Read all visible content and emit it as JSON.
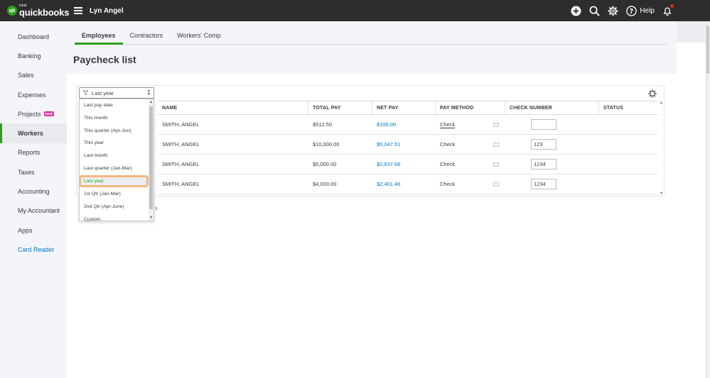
{
  "app": {
    "brand_small": "intuit",
    "brand": "quickbooks",
    "company": "Lyn Angel"
  },
  "topbar": {
    "help_label": "Help",
    "icons": [
      "plus-icon",
      "search-icon",
      "gear-icon",
      "help-icon",
      "bell-icon"
    ]
  },
  "sidebar": {
    "items": [
      {
        "label": "Dashboard"
      },
      {
        "label": "Banking"
      },
      {
        "label": "Sales"
      },
      {
        "label": "Expenses"
      },
      {
        "label": "Projects",
        "badge": "NEW"
      },
      {
        "label": "Workers",
        "active": true
      },
      {
        "label": "Reports"
      },
      {
        "label": "Taxes"
      },
      {
        "label": "Accounting"
      },
      {
        "label": "My Accountant"
      },
      {
        "label": "Apps"
      },
      {
        "label": "Card Reader"
      }
    ]
  },
  "tabs": [
    "Employees",
    "Contractors",
    "Workers' Comp"
  ],
  "page_title": "Paycheck list",
  "filter": {
    "selected": "Last year",
    "options": [
      "Last pay date",
      "This month",
      "This quarter (Apr-Jun)",
      "This year",
      "Last month",
      "Last quarter (Jan-Mar)",
      "Last year",
      "1st Qtr (Jan-Mar)",
      "2nd Qtr (Apr-June)",
      "Custom"
    ]
  },
  "table": {
    "columns": [
      "NAME",
      "TOTAL PAY",
      "NET PAY",
      "PAY METHOD",
      "CHECK NUMBER",
      "STATUS"
    ],
    "rows": [
      {
        "name": "SMITH, ANGEL",
        "total_pay": "$512.50",
        "net_pay": "$100.00",
        "pay_method": "Check",
        "check_number": ""
      },
      {
        "name": "SMITH, ANGEL",
        "total_pay": "$10,000.00",
        "net_pay": "$5,047.51",
        "pay_method": "Check",
        "check_number": "123"
      },
      {
        "name": "SMITH, ANGEL",
        "total_pay": "$5,000.00",
        "net_pay": "$2,837.66",
        "pay_method": "Check",
        "check_number": "1234"
      },
      {
        "name": "SMITH, ANGEL",
        "total_pay": "$4,000.00",
        "net_pay": "$2,401.46",
        "pay_method": "Check",
        "check_number": "1234"
      }
    ]
  },
  "stray_link": "s",
  "colors": {
    "accent_green": "#2ca01c",
    "link_blue": "#0077c5",
    "topbar": "#2d2d2d",
    "highlight": "#f3b87d",
    "badge_pink": "#e12ea4"
  }
}
